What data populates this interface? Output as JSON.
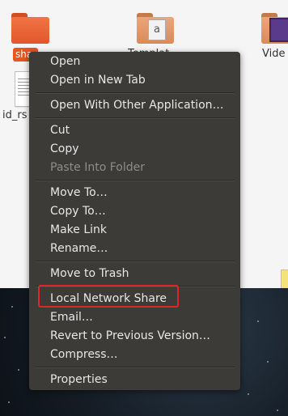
{
  "desktop": {
    "files": [
      {
        "name": "sha",
        "type": "folder",
        "selected": true
      },
      {
        "name": "Templat",
        "type": "folder"
      },
      {
        "name": "Vide",
        "type": "folder"
      },
      {
        "name": "id_rs",
        "type": "document"
      }
    ],
    "colors": {
      "folder": "#e95420",
      "menu_bg": "#3c3b37",
      "highlight_border": "#e0252a"
    }
  },
  "context_menu": {
    "items": {
      "open": "Open",
      "open_new_tab": "Open in New Tab",
      "open_with": "Open With Other Application…",
      "cut": "Cut",
      "copy": "Copy",
      "paste_into_folder": "Paste Into Folder",
      "move_to": "Move To…",
      "copy_to": "Copy To…",
      "make_link": "Make Link",
      "rename": "Rename…",
      "move_to_trash": "Move to Trash",
      "local_network_share": "Local Network Share",
      "email": "Email…",
      "revert": "Revert to Previous Version…",
      "compress": "Compress…",
      "properties": "Properties"
    },
    "disabled": [
      "paste_into_folder"
    ],
    "highlighted": "local_network_share"
  }
}
